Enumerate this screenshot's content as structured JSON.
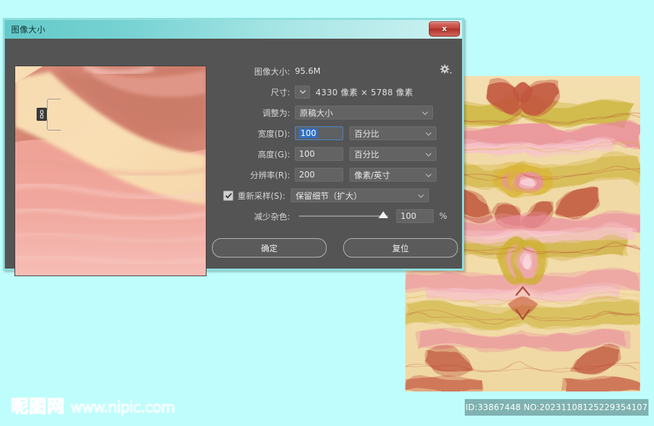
{
  "background_color": "#bffdfd",
  "dialog": {
    "title": "图像大小",
    "close_label": "x",
    "image_size": {
      "label": "图像大小:",
      "value": "95.6M",
      "gear_icon": "gear-icon"
    },
    "dimensions": {
      "label": "尺寸:",
      "value": "4330 像素 × 5788 像素",
      "chevron_icon": "chevron-down-icon"
    },
    "fit_to": {
      "label": "调整为:",
      "value": "原稿大小"
    },
    "width": {
      "label": "宽度(D):",
      "value": "100",
      "unit": "百分比"
    },
    "height": {
      "label": "高度(G):",
      "value": "100",
      "unit": "百分比"
    },
    "resolution": {
      "label": "分辨率(R):",
      "value": "200",
      "unit": "像素/英寸"
    },
    "resample": {
      "label": "重新采样(S):",
      "checked": true,
      "value": "保留细节（扩大）"
    },
    "reduce_noise": {
      "label": "减少杂色:",
      "value": "100",
      "unit": "%"
    },
    "link_icon": "chain-link-icon",
    "buttons": {
      "ok": "确定",
      "reset": "复位"
    }
  },
  "watermark": {
    "site_cn": "昵图网",
    "site_url": "www.nipic.com"
  },
  "id_bar": {
    "text": "ID:33867448 NO:20231108125229354107"
  }
}
